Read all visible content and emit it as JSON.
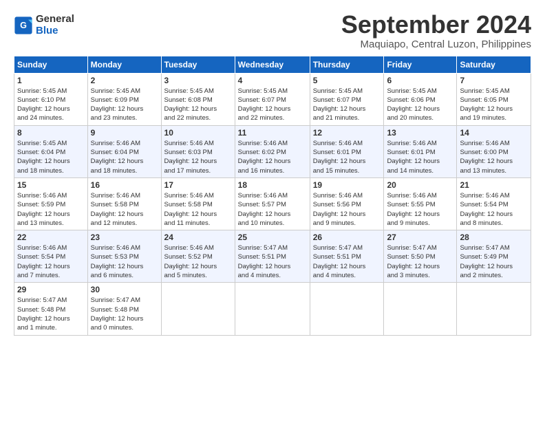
{
  "header": {
    "logo_line1": "General",
    "logo_line2": "Blue",
    "month": "September 2024",
    "location": "Maquiapo, Central Luzon, Philippines"
  },
  "days_of_week": [
    "Sunday",
    "Monday",
    "Tuesday",
    "Wednesday",
    "Thursday",
    "Friday",
    "Saturday"
  ],
  "weeks": [
    [
      {
        "day": 1,
        "content": "Sunrise: 5:45 AM\nSunset: 6:10 PM\nDaylight: 12 hours\nand 24 minutes."
      },
      {
        "day": 2,
        "content": "Sunrise: 5:45 AM\nSunset: 6:09 PM\nDaylight: 12 hours\nand 23 minutes."
      },
      {
        "day": 3,
        "content": "Sunrise: 5:45 AM\nSunset: 6:08 PM\nDaylight: 12 hours\nand 22 minutes."
      },
      {
        "day": 4,
        "content": "Sunrise: 5:45 AM\nSunset: 6:07 PM\nDaylight: 12 hours\nand 22 minutes."
      },
      {
        "day": 5,
        "content": "Sunrise: 5:45 AM\nSunset: 6:07 PM\nDaylight: 12 hours\nand 21 minutes."
      },
      {
        "day": 6,
        "content": "Sunrise: 5:45 AM\nSunset: 6:06 PM\nDaylight: 12 hours\nand 20 minutes."
      },
      {
        "day": 7,
        "content": "Sunrise: 5:45 AM\nSunset: 6:05 PM\nDaylight: 12 hours\nand 19 minutes."
      }
    ],
    [
      {
        "day": 8,
        "content": "Sunrise: 5:45 AM\nSunset: 6:04 PM\nDaylight: 12 hours\nand 18 minutes."
      },
      {
        "day": 9,
        "content": "Sunrise: 5:46 AM\nSunset: 6:04 PM\nDaylight: 12 hours\nand 18 minutes."
      },
      {
        "day": 10,
        "content": "Sunrise: 5:46 AM\nSunset: 6:03 PM\nDaylight: 12 hours\nand 17 minutes."
      },
      {
        "day": 11,
        "content": "Sunrise: 5:46 AM\nSunset: 6:02 PM\nDaylight: 12 hours\nand 16 minutes."
      },
      {
        "day": 12,
        "content": "Sunrise: 5:46 AM\nSunset: 6:01 PM\nDaylight: 12 hours\nand 15 minutes."
      },
      {
        "day": 13,
        "content": "Sunrise: 5:46 AM\nSunset: 6:01 PM\nDaylight: 12 hours\nand 14 minutes."
      },
      {
        "day": 14,
        "content": "Sunrise: 5:46 AM\nSunset: 6:00 PM\nDaylight: 12 hours\nand 13 minutes."
      }
    ],
    [
      {
        "day": 15,
        "content": "Sunrise: 5:46 AM\nSunset: 5:59 PM\nDaylight: 12 hours\nand 13 minutes."
      },
      {
        "day": 16,
        "content": "Sunrise: 5:46 AM\nSunset: 5:58 PM\nDaylight: 12 hours\nand 12 minutes."
      },
      {
        "day": 17,
        "content": "Sunrise: 5:46 AM\nSunset: 5:58 PM\nDaylight: 12 hours\nand 11 minutes."
      },
      {
        "day": 18,
        "content": "Sunrise: 5:46 AM\nSunset: 5:57 PM\nDaylight: 12 hours\nand 10 minutes."
      },
      {
        "day": 19,
        "content": "Sunrise: 5:46 AM\nSunset: 5:56 PM\nDaylight: 12 hours\nand 9 minutes."
      },
      {
        "day": 20,
        "content": "Sunrise: 5:46 AM\nSunset: 5:55 PM\nDaylight: 12 hours\nand 9 minutes."
      },
      {
        "day": 21,
        "content": "Sunrise: 5:46 AM\nSunset: 5:54 PM\nDaylight: 12 hours\nand 8 minutes."
      }
    ],
    [
      {
        "day": 22,
        "content": "Sunrise: 5:46 AM\nSunset: 5:54 PM\nDaylight: 12 hours\nand 7 minutes."
      },
      {
        "day": 23,
        "content": "Sunrise: 5:46 AM\nSunset: 5:53 PM\nDaylight: 12 hours\nand 6 minutes."
      },
      {
        "day": 24,
        "content": "Sunrise: 5:46 AM\nSunset: 5:52 PM\nDaylight: 12 hours\nand 5 minutes."
      },
      {
        "day": 25,
        "content": "Sunrise: 5:47 AM\nSunset: 5:51 PM\nDaylight: 12 hours\nand 4 minutes."
      },
      {
        "day": 26,
        "content": "Sunrise: 5:47 AM\nSunset: 5:51 PM\nDaylight: 12 hours\nand 4 minutes."
      },
      {
        "day": 27,
        "content": "Sunrise: 5:47 AM\nSunset: 5:50 PM\nDaylight: 12 hours\nand 3 minutes."
      },
      {
        "day": 28,
        "content": "Sunrise: 5:47 AM\nSunset: 5:49 PM\nDaylight: 12 hours\nand 2 minutes."
      }
    ],
    [
      {
        "day": 29,
        "content": "Sunrise: 5:47 AM\nSunset: 5:48 PM\nDaylight: 12 hours\nand 1 minute."
      },
      {
        "day": 30,
        "content": "Sunrise: 5:47 AM\nSunset: 5:48 PM\nDaylight: 12 hours\nand 0 minutes."
      },
      null,
      null,
      null,
      null,
      null
    ]
  ]
}
